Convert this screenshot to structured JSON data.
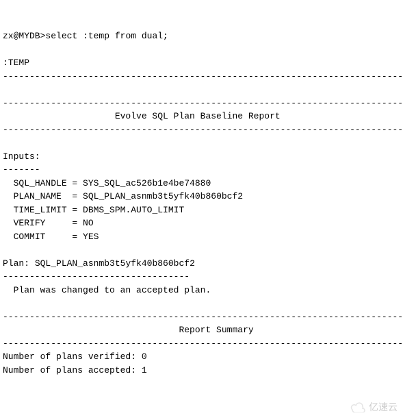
{
  "prompt": "zx@MYDB>",
  "command": "select :temp from dual;",
  "column_header": ":TEMP",
  "dash_line": "---------------------------------------------------------------------------",
  "dash_short": "-------",
  "dash_plan": "-----------------------------------",
  "report_title": "Evolve SQL Plan Baseline Report",
  "inputs_label": "Inputs:",
  "inputs": {
    "sql_handle_label": "SQL_HANDLE",
    "sql_handle_value": "SYS_SQL_ac526b1e4be74880",
    "plan_name_label": "PLAN_NAME",
    "plan_name_value": "SQL_PLAN_asnmb3t5yfk40b860bcf2",
    "time_limit_label": "TIME_LIMIT",
    "time_limit_value": "DBMS_SPM.AUTO_LIMIT",
    "verify_label": "VERIFY",
    "verify_value": "NO",
    "commit_label": "COMMIT",
    "commit_value": "YES"
  },
  "plan_label": "Plan:",
  "plan_value": "SQL_PLAN_asnmb3t5yfk40b860bcf2",
  "plan_result": "Plan was changed to an accepted plan.",
  "summary_title": "Report Summary",
  "verified_label": "Number of plans verified:",
  "verified_value": "0",
  "accepted_label": "Number of plans accepted:",
  "accepted_value": "1",
  "watermark_text": "亿速云"
}
